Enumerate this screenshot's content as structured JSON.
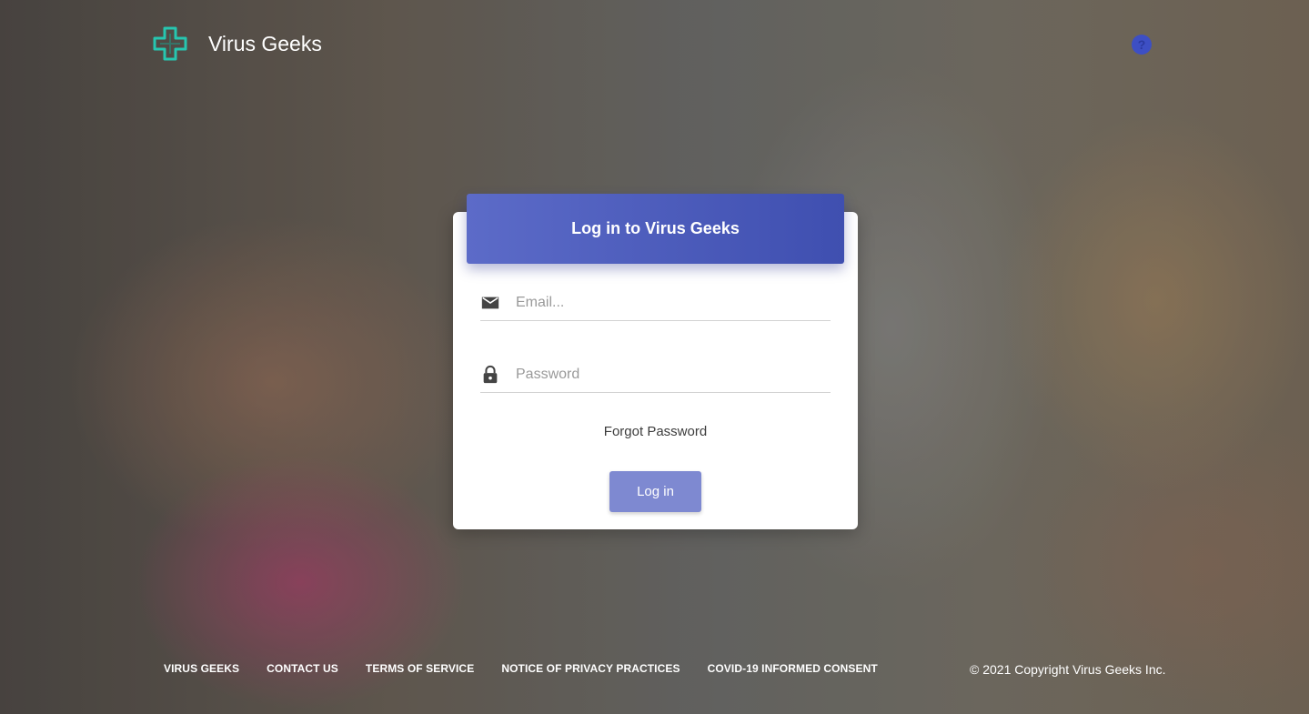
{
  "header": {
    "brand": "Virus Geeks",
    "help_icon": "help-circle-icon",
    "logo_icon": "medical-cross-icon"
  },
  "login": {
    "title": "Log in to Virus Geeks",
    "email": {
      "placeholder": "Email...",
      "value": "",
      "icon": "mail-icon"
    },
    "password": {
      "placeholder": "Password",
      "value": "",
      "icon": "lock-icon"
    },
    "forgot": "Forgot Password",
    "submit": "Log in"
  },
  "footer": {
    "links": [
      "VIRUS GEEKS",
      "CONTACT US",
      "TERMS OF SERVICE",
      "NOTICE OF PRIVACY PRACTICES",
      "COVID-19 INFORMED CONSENT"
    ],
    "copyright": "© 2021 Copyright Virus Geeks Inc."
  },
  "colors": {
    "accent": "#3f51b5",
    "button": "#7e89d1",
    "logo": "#26c6b0"
  }
}
